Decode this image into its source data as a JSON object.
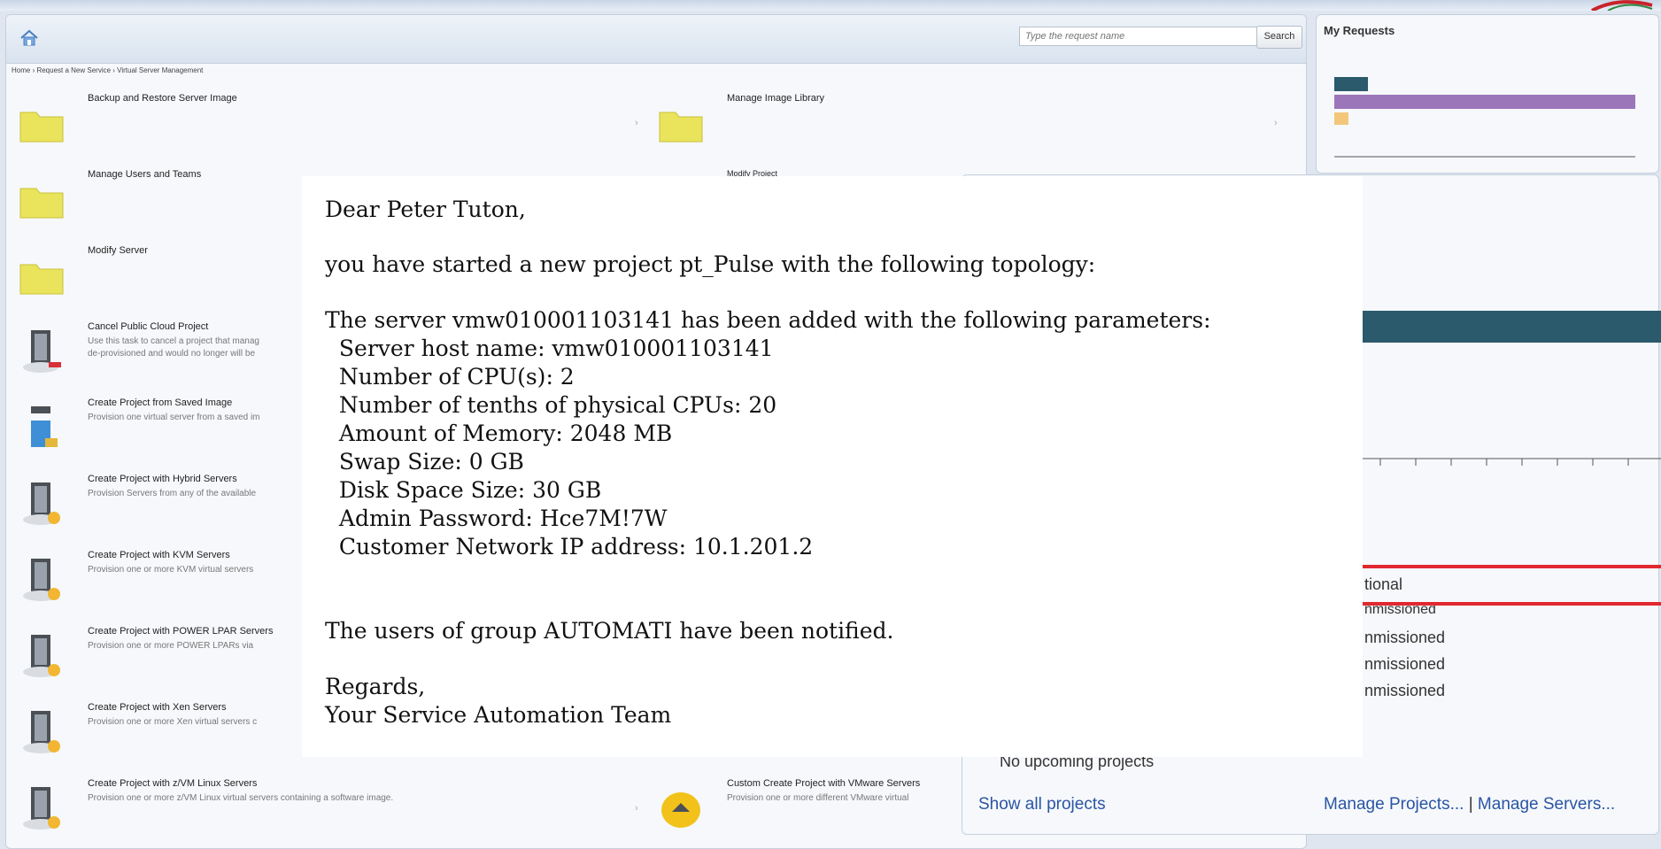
{
  "main": {
    "search": {
      "placeholder": "Type the request name",
      "button": "Search"
    },
    "breadcrumb": "Home › Request a New Service › Virtual Server Management",
    "tasks": [
      {
        "title": "Backup and Restore Server Image",
        "desc1": "",
        "desc2": "",
        "icon": "folder-icon"
      },
      {
        "title": "Manage Image Library",
        "desc1": "",
        "desc2": "",
        "icon": "folder-icon"
      },
      {
        "title": "Manage Users and Teams",
        "desc1": "",
        "desc2": "",
        "icon": "folder-icon"
      },
      {
        "title": "Modify Project",
        "desc1": "",
        "desc2": "",
        "icon": "folder-icon"
      },
      {
        "title": "Modify Server",
        "desc1": "",
        "desc2": "",
        "icon": "folder-icon"
      },
      {
        "title": "Cancel Public Cloud Project",
        "desc1": "Use this task to cancel a project that manag",
        "desc2": "de-provisioned and would no longer will be",
        "icon": "server-icon"
      },
      {
        "title": "Create Project from Saved Image",
        "desc1": "Provision one virtual server from a saved im",
        "desc2": "",
        "icon": "server-image-icon"
      },
      {
        "title": "Create Project with Hybrid Servers",
        "desc1": "Provision Servers from any of the available",
        "desc2": "",
        "icon": "server-icon"
      },
      {
        "title": "Create Project with KVM Servers",
        "desc1": "Provision one or more KVM virtual servers",
        "desc2": "",
        "icon": "server-icon"
      },
      {
        "title": "Create Project with POWER LPAR Servers",
        "desc1": "Provision one or more POWER LPARs via",
        "desc2": "",
        "icon": "server-icon"
      },
      {
        "title": "Create Project with Xen Servers",
        "desc1": "Provision one or more Xen virtual servers c",
        "desc2": "",
        "icon": "server-icon"
      },
      {
        "title": "Create Project with z/VM Linux Servers",
        "desc1": "Provision one or more z/VM Linux virtual servers containing a software image.",
        "desc2": "",
        "icon": "server-icon"
      },
      {
        "title": "Custom Create Project with VMware Servers",
        "desc1": "Provision one or more different VMware virtual",
        "desc2": "",
        "icon": "custom-icon"
      }
    ]
  },
  "requests": {
    "title": "My Requests"
  },
  "projects": {
    "status_items": [
      "tional",
      "nmissioned",
      "nmissioned",
      "nmissioned",
      "nmissioned"
    ],
    "no_upcoming": "No upcoming projects",
    "show_all": "Show all projects",
    "manage_projects": "Manage Projects...",
    "separator": "|",
    "manage_servers": "Manage Servers..."
  },
  "email": {
    "lines": [
      "Dear Peter Tuton,",
      "you have started a new project pt_Pulse with the following topology:",
      "The server vmw010001103141 has been added with the following parameters:",
      "  Server host name: vmw010001103141",
      "  Number of CPU(s): 2",
      "  Number of tenths of physical CPUs: 20",
      "  Amount of Memory: 2048 MB",
      "  Swap Size: 0 GB",
      "  Disk Space Size: 30 GB",
      "  Admin Password: Hce7M!7W",
      "  Customer Network IP address: 10.1.201.2",
      "The users of group AUTOMATI have been notified.",
      "Regards,",
      "Your Service Automation Team"
    ]
  },
  "colors": {
    "accent_bar": "#2a5a6b",
    "highlight_box": "#e0282f",
    "link": "#2a55a3"
  }
}
